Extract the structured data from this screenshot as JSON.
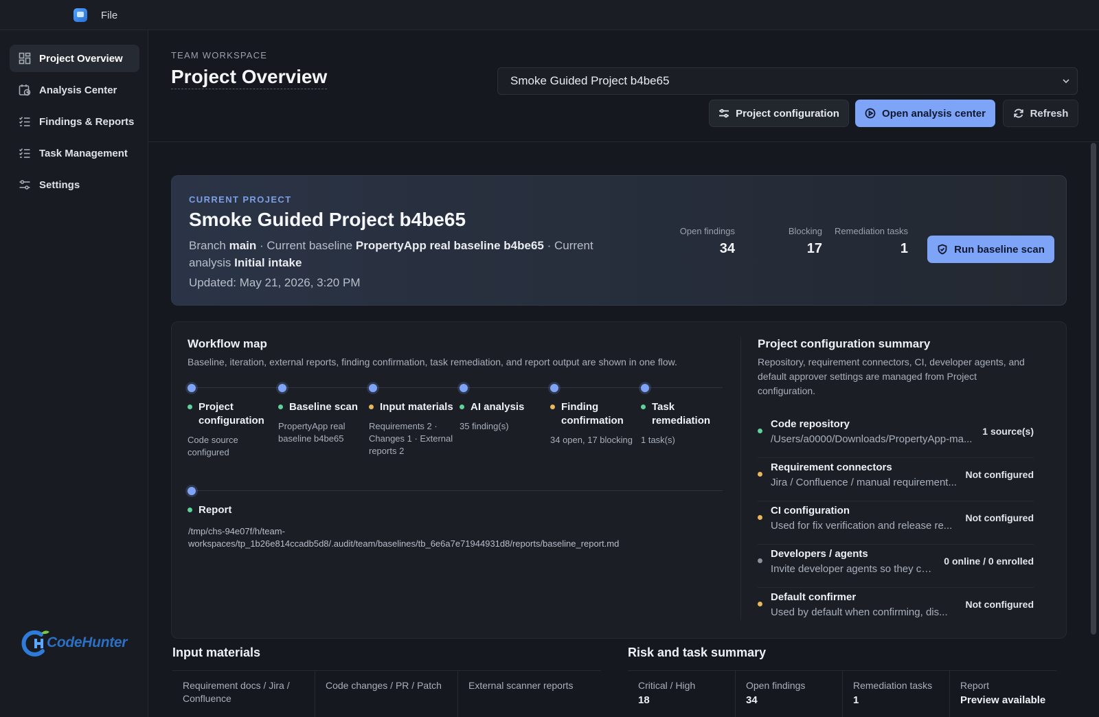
{
  "menubar": {
    "file_label": "File"
  },
  "sidebar": {
    "items": [
      {
        "label": "Project Overview",
        "icon": "dashboard-icon",
        "active": true
      },
      {
        "label": "Analysis Center",
        "icon": "calendar-clock-icon",
        "active": false
      },
      {
        "label": "Findings & Reports",
        "icon": "checklist-icon",
        "active": false
      },
      {
        "label": "Task Management",
        "icon": "checklist-icon",
        "active": false
      },
      {
        "label": "Settings",
        "icon": "sliders-icon",
        "active": false
      }
    ],
    "logo_text": "CodeHunter"
  },
  "header": {
    "eyebrow": "TEAM WORKSPACE",
    "title": "Project Overview",
    "project_select": "Smoke Guided Project b4be65",
    "buttons": {
      "config": "Project configuration",
      "analysis": "Open analysis center",
      "refresh": "Refresh"
    }
  },
  "hero": {
    "eyebrow": "CURRENT PROJECT",
    "title": "Smoke Guided Project b4be65",
    "meta": {
      "branch_prefix": "Branch",
      "branch": "main",
      "baseline_prefix": " · Current baseline",
      "baseline": "PropertyApp real baseline b4be65",
      "analysis_prefix": " · Current analysis",
      "analysis": "Initial intake"
    },
    "updated": "Updated: May 21, 2026, 3:20 PM",
    "stats": [
      {
        "label": "Open findings",
        "value": "34"
      },
      {
        "label": "Blocking",
        "value": "17"
      },
      {
        "label": "Remediation tasks",
        "value": "1"
      }
    ],
    "run_button": "Run baseline scan"
  },
  "workflow": {
    "title": "Workflow map",
    "description": "Baseline, iteration, external reports, finding confirmation, task remediation, and report output are shown in one flow.",
    "steps": [
      {
        "title": "Project configuration",
        "sub": "Code source configured",
        "status": "green"
      },
      {
        "title": "Baseline scan",
        "sub": "PropertyApp real baseline b4be65",
        "status": "green"
      },
      {
        "title": "Input materials",
        "sub": "Requirements 2 · Changes 1 · External reports 2",
        "status": "amber"
      },
      {
        "title": "AI analysis",
        "sub": "35 finding(s)",
        "status": "green"
      },
      {
        "title": "Finding confirmation",
        "sub": "34 open, 17 blocking",
        "status": "amber"
      },
      {
        "title": "Task remediation",
        "sub": "1 task(s)",
        "status": "green"
      }
    ],
    "report": {
      "title": "Report",
      "path": "/tmp/chs-94e07f/h/team-workspaces/tp_1b26e814ccadb5d8/.audit/team/baselines/tb_6e6a7e71944931d8/reports/baseline_report.md",
      "status": "green"
    }
  },
  "config_summary": {
    "title": "Project configuration summary",
    "description": "Repository, requirement connectors, CI, developer agents, and default approver settings are managed from Project configuration.",
    "rows": [
      {
        "name": "Code repository",
        "desc": "/Users/a0000/Downloads/PropertyApp-ma...",
        "status": "1 source(s)",
        "dot": "green"
      },
      {
        "name": "Requirement connectors",
        "desc": "Jira / Confluence / manual requirement...",
        "status": "Not configured",
        "dot": "amber"
      },
      {
        "name": "CI configuration",
        "desc": "Used for fix verification and release re...",
        "status": "Not configured",
        "dot": "amber"
      },
      {
        "name": "Developers / agents",
        "desc": "Invite developer agents so they ca...",
        "status": "0 online / 0 enrolled",
        "dot": "gray"
      },
      {
        "name": "Default confirmer",
        "desc": "Used by default when confirming, dis...",
        "status": "Not configured",
        "dot": "amber"
      }
    ]
  },
  "input_materials": {
    "title": "Input materials",
    "columns": [
      "Requirement docs / Jira / Confluence",
      "Code changes / PR / Patch",
      "External scanner reports"
    ]
  },
  "risk_summary": {
    "title": "Risk and task summary",
    "columns": [
      {
        "label": "Critical / High",
        "value": "18"
      },
      {
        "label": "Open findings",
        "value": "34"
      },
      {
        "label": "Remediation tasks",
        "value": "1"
      },
      {
        "label": "Report",
        "value": "Preview available"
      }
    ]
  }
}
